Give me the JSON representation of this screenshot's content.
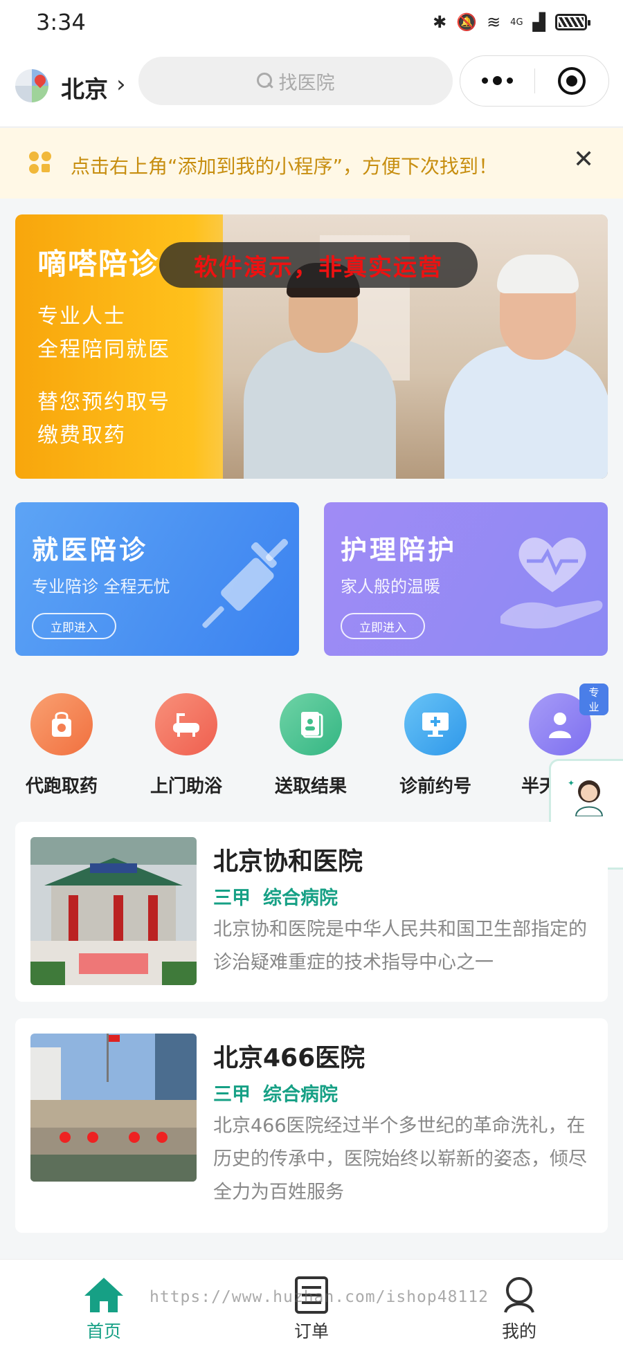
{
  "status_bar": {
    "time": "3:34",
    "network": "4G"
  },
  "header": {
    "city": "北京",
    "search_placeholder": "找医院"
  },
  "notice": {
    "text": "点击右上角“添加到我的小程序”，方便下次找到！"
  },
  "banner": {
    "title": "嘀嗒陪诊",
    "lines": [
      "专业人士",
      "全程陪同就医",
      "替您预约取号",
      "缴费取药"
    ],
    "demo_badge": "软件演示，非真实运营"
  },
  "services": [
    {
      "title": "就医陪诊",
      "subtitle": "专业陪诊 全程无忧",
      "button": "立即进入"
    },
    {
      "title": "护理陪护",
      "subtitle": "家人般的温暖",
      "button": "立即进入"
    }
  ],
  "quick_entries": [
    {
      "label": "代跑取药",
      "icon": "medicine-bag-icon",
      "color": "#f47f52"
    },
    {
      "label": "上门助浴",
      "icon": "bathtub-icon",
      "color": "#f26f5e"
    },
    {
      "label": "送取结果",
      "icon": "report-icon",
      "color": "#3fbf8a"
    },
    {
      "label": "诊前约号",
      "icon": "monitor-cross-icon",
      "color": "#3aa6ee"
    },
    {
      "label": "半天",
      "icon": "nurse-icon",
      "color": "#8a7df0",
      "tag": "专业"
    }
  ],
  "customer_service": {
    "label": "客服"
  },
  "hospitals": [
    {
      "name": "北京协和医院",
      "tags": [
        "三甲",
        "综合病院"
      ],
      "description": "北京协和医院是中华人民共和国卫生部指定的诊治疑难重症的技术指导中心之一"
    },
    {
      "name": "北京466医院",
      "tags": [
        "三甲",
        "综合病院"
      ],
      "description": "北京466医院经过半个多世纪的革命洗礼，在历史的传承中，医院始终以崭新的姿态，倾尽全力为百姓服务"
    }
  ],
  "tab_bar": [
    {
      "label": "首页",
      "icon": "home-icon",
      "active": true
    },
    {
      "label": "订单",
      "icon": "order-list-icon",
      "active": false
    },
    {
      "label": "我的",
      "icon": "profile-icon",
      "active": false
    }
  ],
  "watermark": "https://www.huzhan.com/ishop48112",
  "colors": {
    "accent": "#16a085",
    "notice_text": "#c78e10",
    "demo_text": "#ee1111"
  }
}
